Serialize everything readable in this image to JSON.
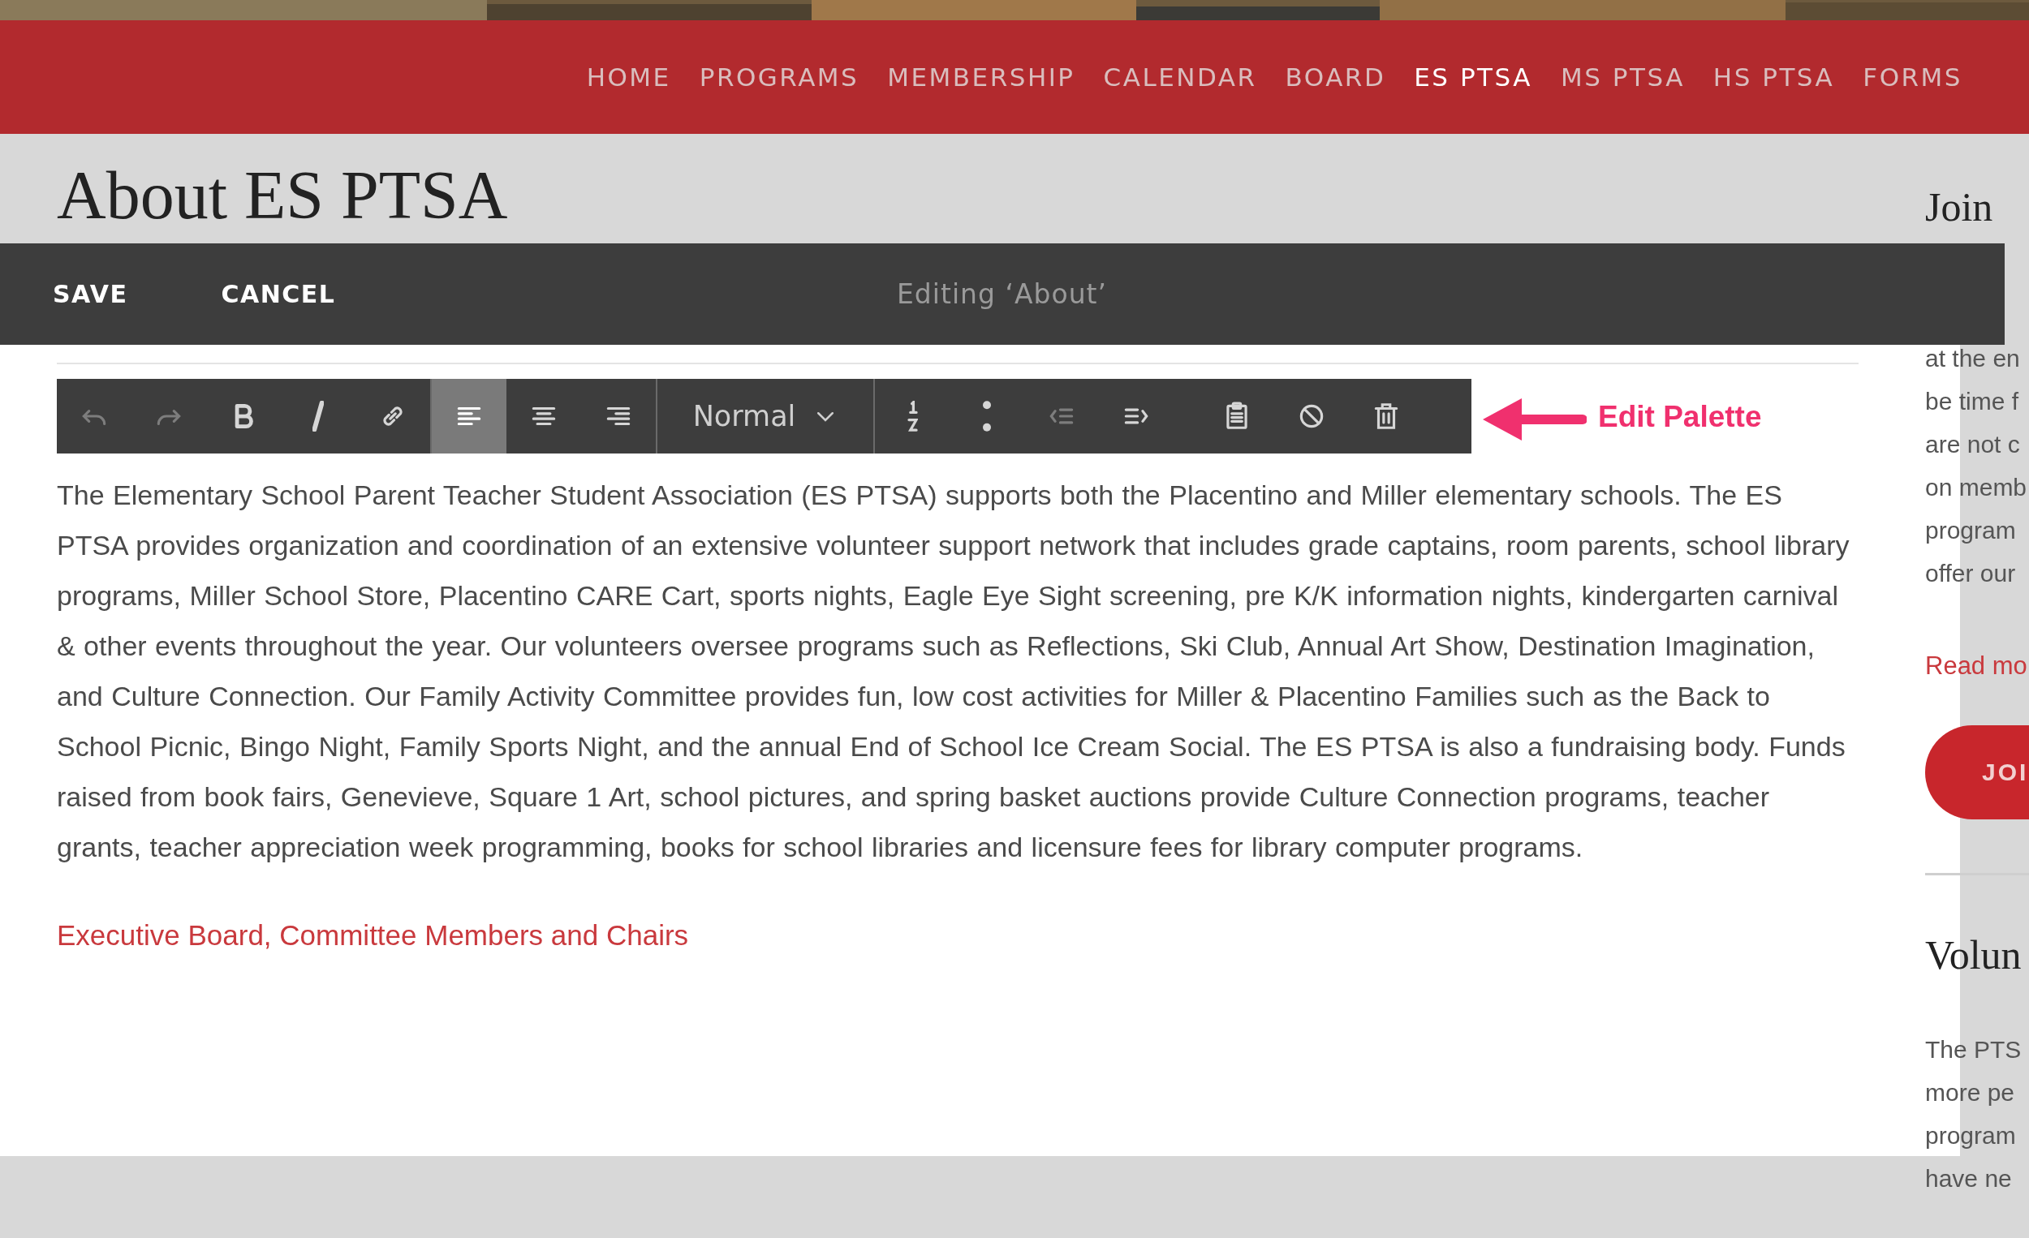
{
  "nav": {
    "items": [
      {
        "label": "HOME",
        "selected": false
      },
      {
        "label": "PROGRAMS",
        "selected": false
      },
      {
        "label": "MEMBERSHIP",
        "selected": false
      },
      {
        "label": "CALENDAR",
        "selected": false
      },
      {
        "label": "BOARD",
        "selected": false
      },
      {
        "label": "ES PTSA",
        "selected": true
      },
      {
        "label": "MS PTSA",
        "selected": false
      },
      {
        "label": "HS PTSA",
        "selected": false
      },
      {
        "label": "FORMS",
        "selected": false
      }
    ]
  },
  "page_heading": "About ES PTSA",
  "edit_bar": {
    "buttons": [
      "SAVE",
      "CANCEL"
    ],
    "title": "Editing ‘About’"
  },
  "toolbar": {
    "groups": [
      [
        {
          "kind": "undo",
          "disabled": true,
          "selected": false
        },
        {
          "kind": "redo",
          "disabled": true,
          "selected": false
        },
        {
          "kind": "bold",
          "disabled": false,
          "selected": false
        },
        {
          "kind": "italic",
          "disabled": false,
          "selected": false
        },
        {
          "kind": "link",
          "disabled": false,
          "selected": false
        }
      ],
      [
        {
          "kind": "align-left",
          "disabled": false,
          "selected": true
        },
        {
          "kind": "align-center",
          "disabled": false,
          "selected": false
        },
        {
          "kind": "align-right",
          "disabled": false,
          "selected": false
        }
      ],
      [
        {
          "kind": "dropdown",
          "label": "Normal",
          "disabled": false,
          "selected": false
        }
      ],
      [
        {
          "kind": "ordered-list",
          "disabled": false,
          "selected": false
        },
        {
          "kind": "bullet-list",
          "disabled": false,
          "selected": false
        },
        {
          "kind": "outdent",
          "disabled": true,
          "selected": false
        },
        {
          "kind": "indent",
          "disabled": false,
          "selected": false
        },
        {
          "kind": "spacer"
        },
        {
          "kind": "paste",
          "disabled": false,
          "selected": false
        },
        {
          "kind": "clear-format",
          "disabled": false,
          "selected": false
        },
        {
          "kind": "delete",
          "disabled": false,
          "selected": false
        }
      ]
    ]
  },
  "body_text": "The Elementary School Parent Teacher Student Association (ES PTSA) supports both the Placentino and Miller elementary schools. The ES PTSA provides organization and coordination of an extensive volunteer support network that includes grade captains, room parents,  school library programs, Miller School Store, Placentino CARE Cart, sports nights, Eagle Eye Sight screening,  pre K/K information nights, kindergarten carnival & other events throughout the year.  Our volunteers oversee programs such as Reflections, Ski Club, Annual Art Show, Destination Imagination, and Culture Connection.  Our Family Activity Committee provides fun, low cost activities for Miller & Placentino Families such as the Back to School Picnic, Bingo Night, Family Sports Night, and the annual End of School Ice Cream Social.  The ES PTSA is also a fundraising body.  Funds raised from book fairs, Genevieve, Square 1 Art, school pictures, and spring basket auctions provide Culture Connection programs, teacher grants, teacher appreciation week programming, books for school libraries and licensure fees for library computer programs.",
  "link": "Executive Board, Committee Members and Chairs",
  "annotation": {
    "label": "Edit Palette"
  },
  "sidebar": {
    "heading": "Join",
    "lines": [
      "at the en",
      "be time f",
      "are not c",
      "on memb",
      "program",
      "offer our"
    ],
    "link": "Read mo",
    "button": "JOI",
    "heading_2": "Volun",
    "lines_2": [
      "The PTS",
      "more pe",
      "program",
      "have ne"
    ]
  }
}
